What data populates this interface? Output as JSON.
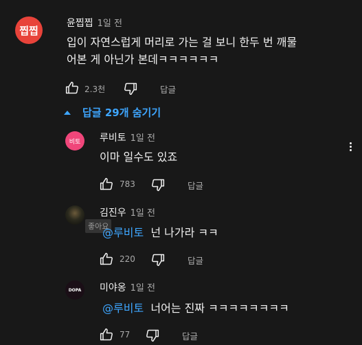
{
  "comment": {
    "author": "윤찝찝",
    "avatar_text": "찝찝",
    "avatar_color": "#e8433a",
    "time": "1일 전",
    "text_line1": "입이 자연스럽게 머리로 가는 걸 보니 한두 번 깨물",
    "text_line2": "어본 게 아닌가 본데ㅋㅋㅋㅋㅋㅋ",
    "likes": "2.3천",
    "reply_label": "답글"
  },
  "replies_toggle": {
    "label": "답글 29개 숨기기"
  },
  "replies": [
    {
      "author": "루비토",
      "avatar_text": "비토",
      "avatar_color": "#f0467a",
      "time": "1일 전",
      "mention": "",
      "text": "이마 일수도 있죠",
      "likes": "783",
      "reply_label": "답글"
    },
    {
      "author": "김진우",
      "time": "1일 전",
      "mention": "@루비토",
      "text": "넌 나가라 ㅋㅋ",
      "likes": "220",
      "reply_label": "답글",
      "tooltip": "좋아요"
    },
    {
      "author": "미야옹",
      "avatar_text": "DOPA",
      "time": "1일 전",
      "mention": "@루비토",
      "text": "너어는 진짜 ㅋㅋㅋㅋㅋㅋㅋㅋ",
      "likes": "77",
      "reply_label": "답글"
    }
  ]
}
